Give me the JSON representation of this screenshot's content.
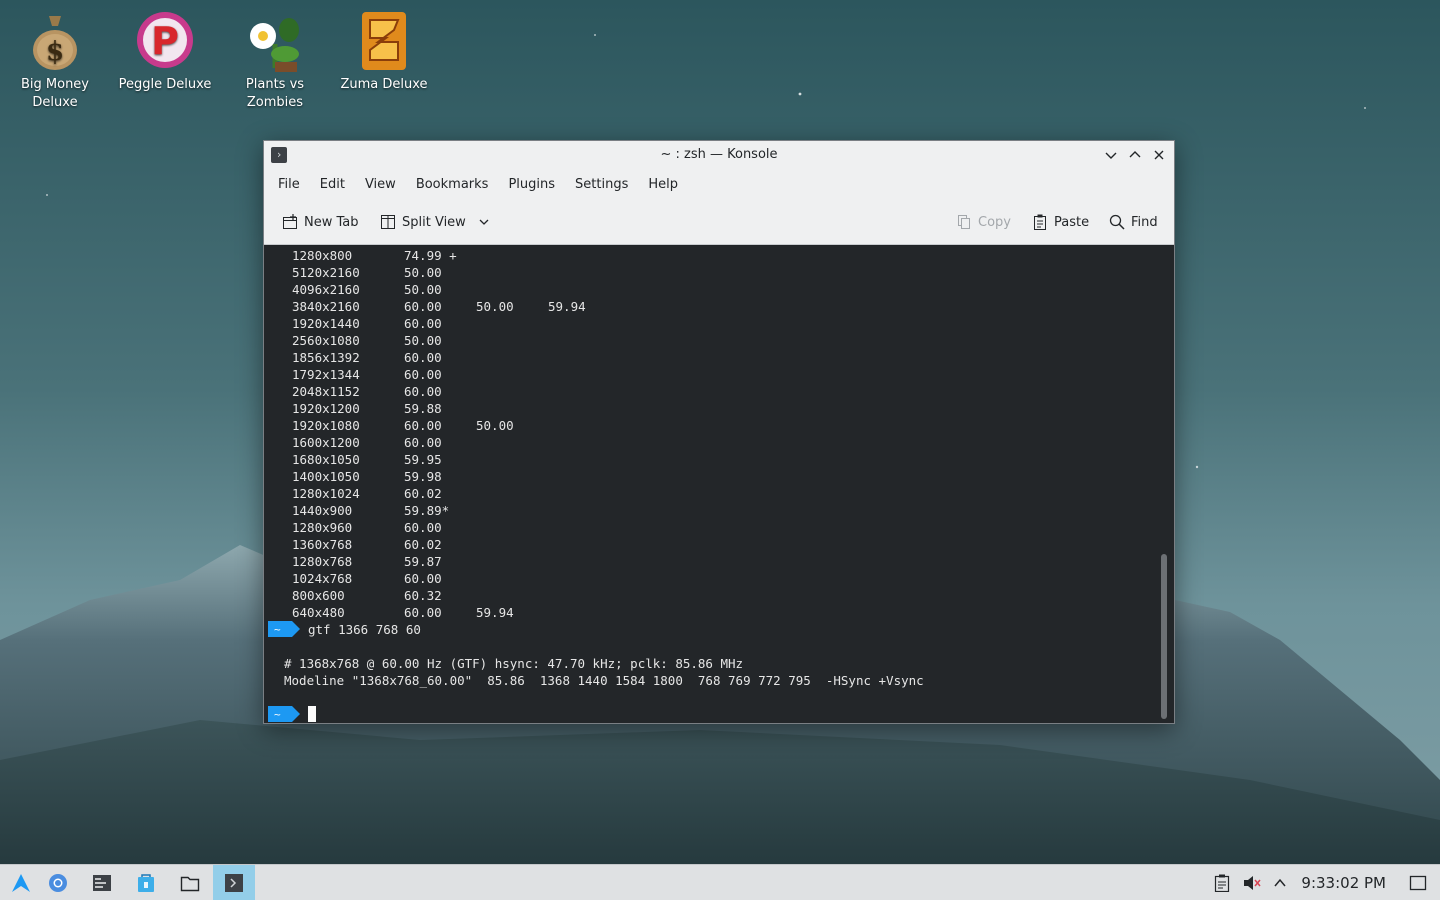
{
  "desktop": {
    "icons": [
      {
        "label": "Big Money\nDeluxe",
        "icon": "money-bag-icon"
      },
      {
        "label": "Peggle Deluxe",
        "icon": "peggle-icon"
      },
      {
        "label": "Plants vs\nZombies",
        "icon": "plants-icon"
      },
      {
        "label": "Zuma Deluxe",
        "icon": "zuma-icon"
      }
    ]
  },
  "window": {
    "title": "~ : zsh — Konsole",
    "menu": [
      "File",
      "Edit",
      "View",
      "Bookmarks",
      "Plugins",
      "Settings",
      "Help"
    ],
    "toolbar": {
      "new_tab": "New Tab",
      "split_view": "Split View",
      "copy": "Copy",
      "paste": "Paste",
      "find": "Find"
    }
  },
  "terminal": {
    "modes": [
      {
        "res": "1280x800",
        "rates": [
          "74.99 +"
        ]
      },
      {
        "res": "5120x2160",
        "rates": [
          "50.00"
        ]
      },
      {
        "res": "4096x2160",
        "rates": [
          "50.00"
        ]
      },
      {
        "res": "3840x2160",
        "rates": [
          "60.00",
          "50.00",
          "59.94"
        ]
      },
      {
        "res": "1920x1440",
        "rates": [
          "60.00"
        ]
      },
      {
        "res": "2560x1080",
        "rates": [
          "50.00"
        ]
      },
      {
        "res": "1856x1392",
        "rates": [
          "60.00"
        ]
      },
      {
        "res": "1792x1344",
        "rates": [
          "60.00"
        ]
      },
      {
        "res": "2048x1152",
        "rates": [
          "60.00"
        ]
      },
      {
        "res": "1920x1200",
        "rates": [
          "59.88"
        ]
      },
      {
        "res": "1920x1080",
        "rates": [
          "60.00",
          "50.00"
        ]
      },
      {
        "res": "1600x1200",
        "rates": [
          "60.00"
        ]
      },
      {
        "res": "1680x1050",
        "rates": [
          "59.95"
        ]
      },
      {
        "res": "1400x1050",
        "rates": [
          "59.98"
        ]
      },
      {
        "res": "1280x1024",
        "rates": [
          "60.02"
        ]
      },
      {
        "res": "1440x900",
        "rates": [
          "59.89*"
        ]
      },
      {
        "res": "1280x960",
        "rates": [
          "60.00"
        ]
      },
      {
        "res": "1360x768",
        "rates": [
          "60.02"
        ]
      },
      {
        "res": "1280x768",
        "rates": [
          "59.87"
        ]
      },
      {
        "res": "1024x768",
        "rates": [
          "60.00"
        ]
      },
      {
        "res": "800x600",
        "rates": [
          "60.32"
        ]
      },
      {
        "res": "640x480",
        "rates": [
          "60.00",
          "59.94"
        ]
      }
    ],
    "prompt_symbol": "~",
    "command": "gtf 1366 768 60",
    "output": [
      "# 1368x768 @ 60.00 Hz (GTF) hsync: 47.70 kHz; pclk: 85.86 MHz",
      "Modeline \"1368x768_60.00\"  85.86  1368 1440 1584 1800  768 769 772 795  -HSync +Vsync"
    ]
  },
  "taskbar": {
    "apps": [
      "app-launcher-icon",
      "browser-icon",
      "system-monitor-icon",
      "discover-icon",
      "file-manager-icon",
      "konsole-icon"
    ],
    "clock": "9:33:02 PM"
  },
  "colors": {
    "prompt_blue": "#1d99f3",
    "taskbar_active": "#93cee9",
    "terminal_bg": "#232629"
  }
}
